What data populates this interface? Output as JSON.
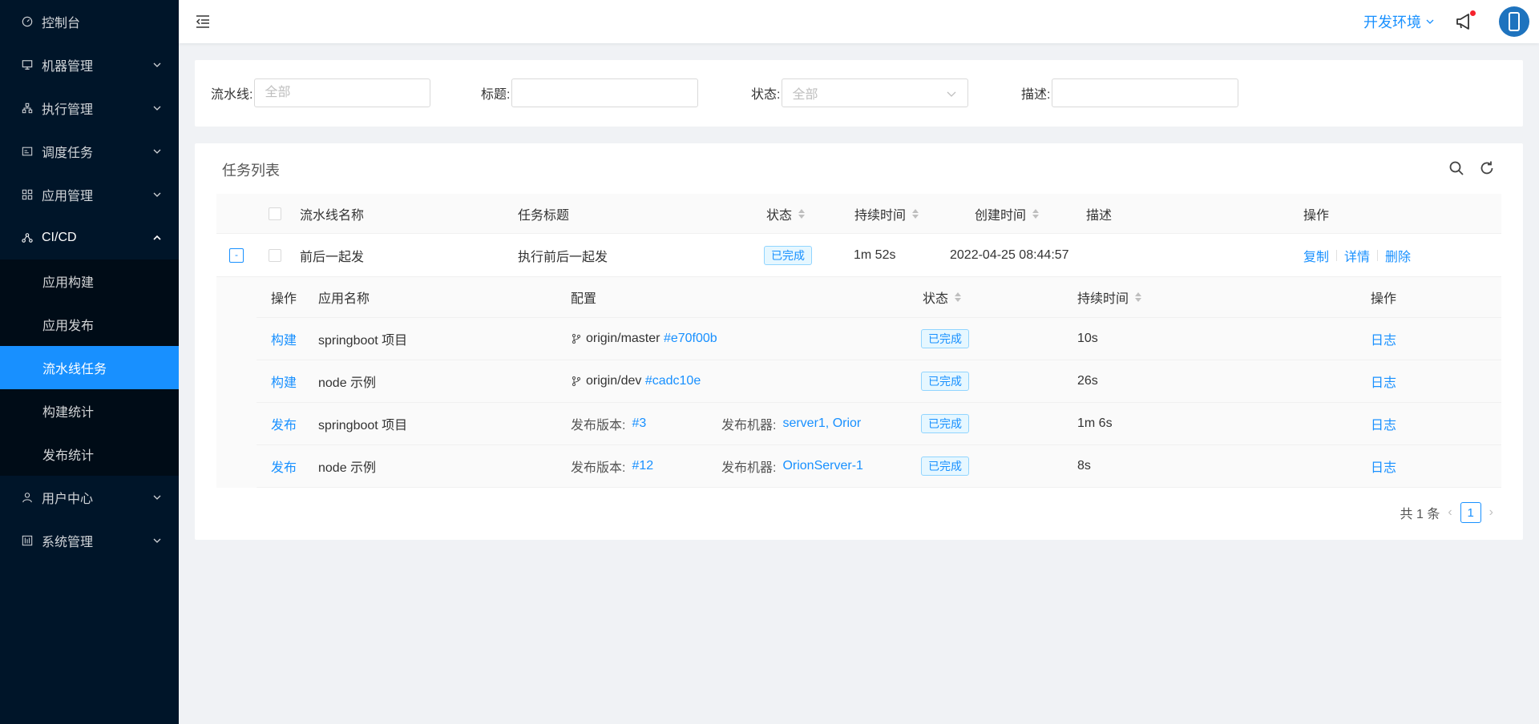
{
  "sidebar": {
    "items": [
      {
        "label": "控制台",
        "icon": "dashboard-icon"
      },
      {
        "label": "机器管理",
        "icon": "desktop-icon"
      },
      {
        "label": "执行管理",
        "icon": "cluster-icon"
      },
      {
        "label": "调度任务",
        "icon": "schedule-icon"
      },
      {
        "label": "应用管理",
        "icon": "appstore-icon"
      },
      {
        "label": "CI/CD",
        "icon": "deployment-icon"
      },
      {
        "label": "用户中心",
        "icon": "user-icon"
      },
      {
        "label": "系统管理",
        "icon": "setting-icon"
      }
    ],
    "cicd_sub": [
      {
        "label": "应用构建"
      },
      {
        "label": "应用发布"
      },
      {
        "label": "流水线任务"
      },
      {
        "label": "构建统计"
      },
      {
        "label": "发布统计"
      }
    ]
  },
  "header": {
    "env_label": "开发环境"
  },
  "filters": {
    "pipeline_label": "流水线:",
    "pipeline_placeholder": "全部",
    "title_label": "标题:",
    "title_value": "",
    "status_label": "状态:",
    "status_value": "全部",
    "desc_label": "描述:",
    "desc_value": ""
  },
  "task_list": {
    "title": "任务列表",
    "columns": [
      "流水线名称",
      "任务标题",
      "状态",
      "持续时间",
      "创建时间",
      "描述",
      "操作"
    ],
    "rows": [
      {
        "expand_symbol": "-",
        "pipeline": "前后一起发",
        "task_title": "执行前后一起发",
        "status": "已完成",
        "duration": "1m 52s",
        "created": "2022-04-25 08:44:57",
        "desc": "",
        "actions": [
          "复制",
          "详情",
          "删除"
        ]
      }
    ],
    "nested": {
      "columns": [
        "操作",
        "应用名称",
        "配置",
        "状态",
        "持续时间",
        "操作"
      ],
      "rows": [
        {
          "type": "构建",
          "app": "springboot 项目",
          "branch": "origin/master",
          "commit": "#e70f00b",
          "status": "已完成",
          "duration": "10s",
          "action": "日志"
        },
        {
          "type": "构建",
          "app": "node 示例",
          "branch": "origin/dev",
          "commit": "#cadc10e",
          "status": "已完成",
          "duration": "26s",
          "action": "日志"
        },
        {
          "type": "发布",
          "app": "springboot 项目",
          "version_label": "发布版本:",
          "version": "#3",
          "machine_label": "发布机器:",
          "machines": "server1, Orior",
          "status": "已完成",
          "duration": "1m 6s",
          "action": "日志"
        },
        {
          "type": "发布",
          "app": "node 示例",
          "version_label": "发布版本:",
          "version": "#12",
          "machine_label": "发布机器:",
          "machines": "OrionServer-1",
          "status": "已完成",
          "duration": "8s",
          "action": "日志"
        }
      ]
    },
    "pagination": {
      "total": "共 1 条",
      "current": "1"
    }
  },
  "colors": {
    "primary": "#1890ff",
    "sidebar_bg": "#001529",
    "submenu_bg": "#000c17"
  }
}
